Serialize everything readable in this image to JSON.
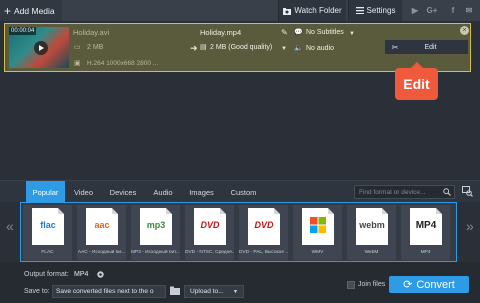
{
  "toolbar": {
    "add_media": "Add Media",
    "watch_folder": "Watch Folder",
    "settings": "Settings",
    "social": [
      "▶",
      "G+",
      "f",
      "✉"
    ]
  },
  "file": {
    "thumb_time": "00:00:04",
    "source_name": "Holiday.avi",
    "source_size": "2 MB",
    "source_info": "H.264 1000x668 2800 ...",
    "output_name": "Holiday.mp4",
    "output_size": "2 MB (Good quality)",
    "subtitles": "No Subtitles",
    "audio": "No audio",
    "edit": "Edit"
  },
  "callout": {
    "text": "Edit"
  },
  "tabs": [
    "Popular",
    "Video",
    "Devices",
    "Audio",
    "Images",
    "Custom"
  ],
  "active_tab": "Popular",
  "search": {
    "placeholder": "Find format or device..."
  },
  "formats": [
    {
      "logo": "flac",
      "label": "FLAC",
      "color": "#1f7bc2"
    },
    {
      "logo": "aac",
      "label": "AAC - Исходный би...",
      "color": "#d66b1c"
    },
    {
      "logo": "mp3",
      "label": "MP3 - Исходный бит...",
      "color": "#3a8a3a"
    },
    {
      "logo": "DVD",
      "label": "DVD - NTSC, Средне...",
      "color": "#c0181e"
    },
    {
      "logo": "DVD",
      "label": "DVD - PAL, Высокое ...",
      "color": "#c0181e"
    },
    {
      "logo": "wmv",
      "label": "WMV",
      "color": "#2a7acb"
    },
    {
      "logo": "webm",
      "label": "WebM",
      "color": "#444444"
    },
    {
      "logo": "MP4",
      "label": "MP4",
      "color": "#222222"
    }
  ],
  "bottom": {
    "output_format_label": "Output format:",
    "output_format_value": "MP4",
    "save_to_label": "Save to:",
    "save_to_value": "Save converted files next to the o",
    "upload_to": "Upload to...",
    "join_files": "Join files",
    "convert": "Convert"
  },
  "colors": {
    "accent": "#2d9be6",
    "highlight_border": "#d0bf49",
    "callout": "#ef5a3d"
  }
}
